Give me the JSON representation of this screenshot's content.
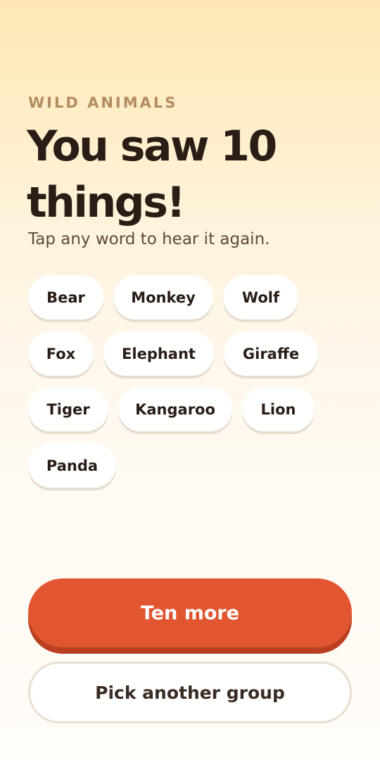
{
  "header": {
    "category": "WILD ANIMALS",
    "headline": "You saw 10 things!",
    "subtitle": "Tap any word to hear it again."
  },
  "words": [
    "Bear",
    "Monkey",
    "Wolf",
    "Fox",
    "Elephant",
    "Giraffe",
    "Tiger",
    "Kangaroo",
    "Lion",
    "Panda"
  ],
  "actions": {
    "primary_label": "Ten more",
    "secondary_label": "Pick another group"
  },
  "colors": {
    "accent": "#E15530",
    "accent_shadow": "#B93F20",
    "category_text": "#B38C60",
    "heading_text": "#2A1D16",
    "background_top": "#FEE7B3",
    "background_bottom": "#FFFDF9"
  }
}
